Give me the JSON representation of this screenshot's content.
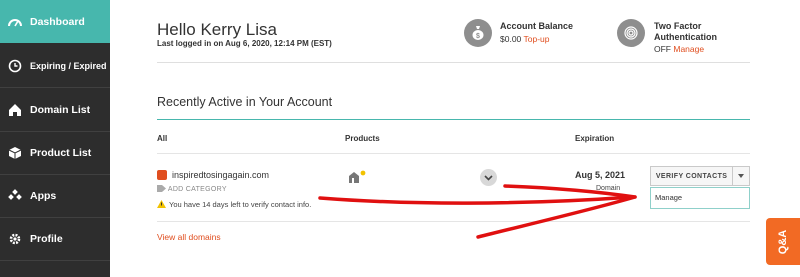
{
  "sidebar": {
    "items": [
      {
        "label": "Dashboard",
        "icon": "speedometer-icon",
        "active": true
      },
      {
        "label": "Expiring / Expired",
        "icon": "clock-icon",
        "active": false
      },
      {
        "label": "Domain List",
        "icon": "home-icon",
        "active": false
      },
      {
        "label": "Product List",
        "icon": "box-icon",
        "active": false
      },
      {
        "label": "Apps",
        "icon": "apps-icon",
        "active": false
      },
      {
        "label": "Profile",
        "icon": "gear-icon",
        "active": false
      }
    ]
  },
  "header": {
    "greeting": "Hello Kerry Lisa",
    "last_logged": "Last logged in on Aug 6, 2020, 12:14 PM (EST)",
    "account_balance": {
      "label": "Account Balance",
      "amount": "$0.00",
      "link": "Top-up",
      "icon": "money-bag-icon"
    },
    "two_factor": {
      "label_line1": "Two Factor",
      "label_line2": "Authentication",
      "status": "OFF",
      "link": "Manage",
      "icon": "fingerprint-icon"
    }
  },
  "recent": {
    "title": "Recently Active in Your Account",
    "columns": [
      "All",
      "Products",
      "Expiration"
    ],
    "row": {
      "domain": "inspiredtosingagain.com",
      "add_category": "ADD CATEGORY",
      "warning": "You have 14 days left to verify contact info.",
      "expiration_date": "Aug 5, 2021",
      "expiration_sub": "Domain",
      "action_label": "VERIFY CONTACTS",
      "dropdown_option": "Manage"
    },
    "view_all": "View all domains"
  },
  "qa_tab": {
    "label": "Q&A"
  },
  "colors": {
    "sidebar_bg": "#2d2d2d",
    "accent": "#47b7ad",
    "link": "#e04e1f",
    "qa": "#f26a24",
    "annotation": "#e01010"
  }
}
